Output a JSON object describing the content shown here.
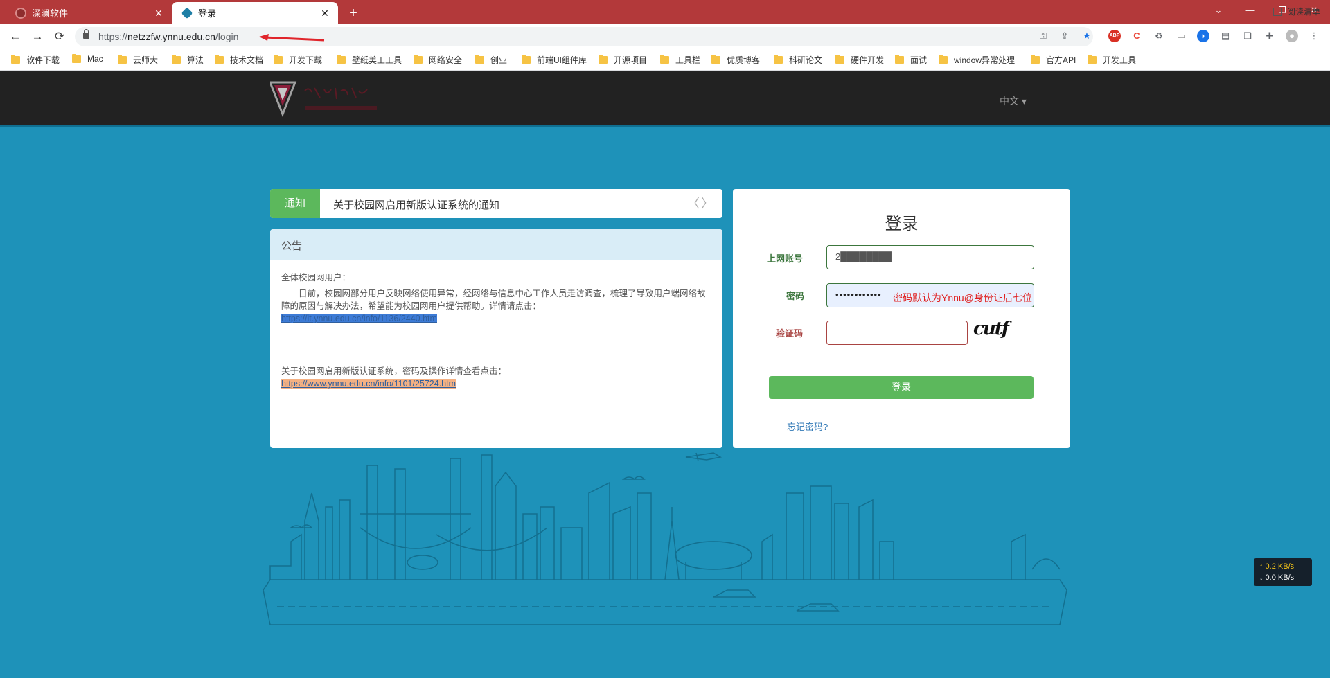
{
  "browser": {
    "tabs": [
      {
        "title": "深澜软件",
        "active": false
      },
      {
        "title": "登录",
        "active": true
      }
    ],
    "url_host": "netzzfw.ynnu.edu.cn",
    "url_path": "/login",
    "url_scheme": "https://",
    "new_tab_symbol": "+",
    "window_controls": [
      "⌄",
      "—",
      "❐",
      "✕"
    ],
    "nav": {
      "back": "←",
      "forward": "→",
      "reload": "⟳"
    },
    "bookmarks": [
      "软件下载",
      "Mac",
      "云师大",
      "算法",
      "技术文档",
      "开发下载",
      "壁纸美工工具",
      "网络安全",
      "创业",
      "前端UI组件库",
      "开源项目",
      "工具栏",
      "优质博客",
      "科研论文",
      "硬件开发",
      "面试",
      "window异常处理",
      "官方API",
      "开发工具"
    ],
    "reading_list": "阅读清单",
    "accent": "#b3393a"
  },
  "site": {
    "language": "中文 ▾",
    "notice": {
      "tag": "通知",
      "text": "关于校园网启用新版认证系统的通知",
      "prev": "〈",
      "next": "〉"
    },
    "announcement": {
      "title": "公告",
      "greeting": "全体校园网用户：",
      "body": "　　目前，校园网部分用户反映网络使用异常，经网络与信息中心工作人员走访调查，梳理了导致用户端网络故障的原因与解决办法，希望能为校园网用户提供帮助。详情请点击：",
      "link1": "https://it.ynnu.edu.cn/info/1136/2440.htm",
      "body2": " 关于校园网启用新版认证系统，密码及操作详情查看点击：",
      "link2": "https://www.ynnu.edu.cn/info/1101/25724.htm"
    },
    "login": {
      "title": "登录",
      "account_label": "上网账号",
      "account_value": "2████████",
      "password_label": "密码",
      "password_value": "••••••••••••",
      "password_hint": "密码默认为Ynnu@身份证后七位",
      "captcha_label": "验证码",
      "captcha_value": "",
      "captcha_image_text": "cutf",
      "submit": "登录",
      "forgot": "忘记密码?"
    },
    "speed": {
      "up": "↑ 0.2 KB/s",
      "down": "↓ 0.0 KB/s"
    },
    "bg_color": "#1e92b9",
    "success_color": "#5cb85c"
  }
}
